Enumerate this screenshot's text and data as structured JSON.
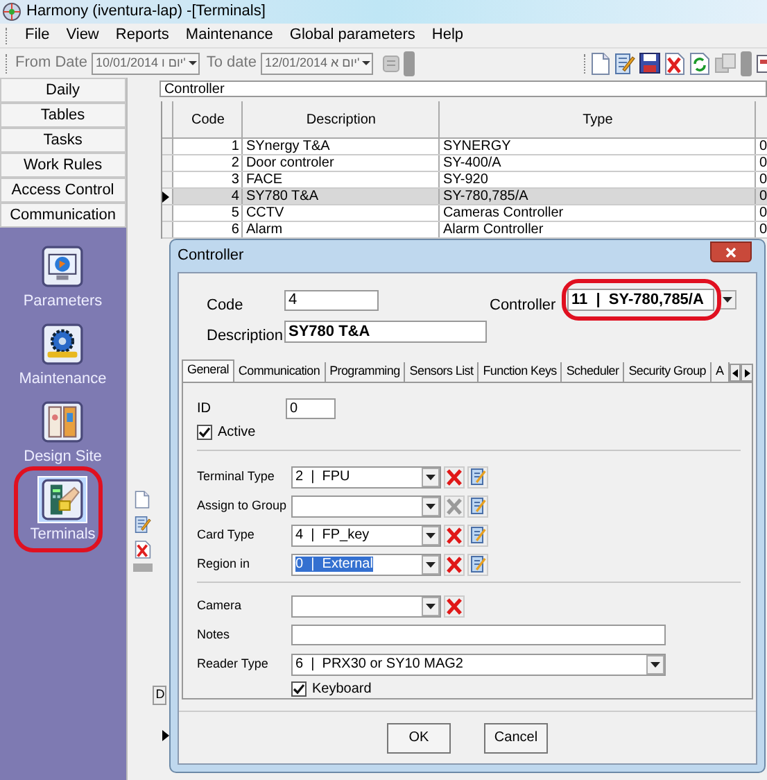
{
  "window": {
    "title": "Harmony (iventura-lap) -[Terminals]"
  },
  "menu": [
    "File",
    "View",
    "Reports",
    "Maintenance",
    "Global parameters",
    "Help"
  ],
  "toolbar": {
    "from_date": {
      "label": "From Date",
      "value": "10/01/2014 יום ו'"
    },
    "to_date": {
      "label": "To date",
      "value": "12/01/2014 יום א'"
    }
  },
  "sidebar": {
    "sections": [
      {
        "label": "Daily",
        "selected": false
      },
      {
        "label": "Tables",
        "selected": false
      },
      {
        "label": "Tasks",
        "selected": false
      },
      {
        "label": "Work Rules",
        "selected": false
      },
      {
        "label": "Access Control",
        "selected": false
      },
      {
        "label": "Communication",
        "selected": false
      }
    ],
    "modules": [
      {
        "label": "Parameters",
        "kind": "monitor",
        "selected": false,
        "circled": false
      },
      {
        "label": "Maintenance",
        "kind": "gear",
        "selected": false,
        "circled": false
      },
      {
        "label": "Design Site",
        "kind": "door",
        "selected": false,
        "circled": false
      },
      {
        "label": "Terminals",
        "kind": "terminal",
        "selected": true,
        "circled": true
      }
    ]
  },
  "grid": {
    "title": "Controller",
    "columns": [
      "Code",
      "Description",
      "Type"
    ],
    "rows": [
      {
        "code": "1",
        "description": "SYnergy T&A",
        "type": "SYNERGY",
        "column_4": "0",
        "selected": false
      },
      {
        "code": "2",
        "description": "Door controler",
        "type": "SY-400/A",
        "column_4": "0",
        "selected": false
      },
      {
        "code": "3",
        "description": "FACE",
        "type": "SY-920",
        "column_4": "0",
        "selected": false
      },
      {
        "code": "4",
        "description": "SY780 T&A",
        "type": "SY-780,785/A",
        "column_4": "0",
        "selected": true
      },
      {
        "code": "5",
        "description": "CCTV",
        "type": "Cameras Controller",
        "column_4": "0",
        "selected": false
      },
      {
        "code": "6",
        "description": "Alarm",
        "type": "Alarm Controller",
        "column_4": "0",
        "selected": false
      }
    ],
    "bottom_button": "D"
  },
  "dialog": {
    "title": "Controller",
    "code": {
      "label": "Code",
      "value": "4"
    },
    "controller": {
      "label": "Controller",
      "value": "11  |  SY-780,785/A",
      "circled": true
    },
    "description": {
      "label": "Description",
      "value": "SY780 T&A"
    },
    "tabs": [
      {
        "label": "General",
        "selected": true
      },
      {
        "label": "Communication",
        "selected": false
      },
      {
        "label": "Programming",
        "selected": false
      },
      {
        "label": "Sensors List",
        "selected": false
      },
      {
        "label": "Function Keys",
        "selected": false
      },
      {
        "label": "Scheduler",
        "selected": false
      },
      {
        "label": "Security Group",
        "selected": false
      },
      {
        "label": "A",
        "selected": false
      }
    ],
    "id": {
      "label": "ID",
      "value": "0"
    },
    "active": {
      "label": "Active",
      "checked": true
    },
    "fields": [
      {
        "kind": "combo",
        "label": "Terminal Type",
        "value": "2  |  FPU",
        "clear_enabled": true,
        "editable": true
      },
      {
        "kind": "combo",
        "label": "Assign to Group",
        "clear_enabled": false,
        "editable": true
      },
      {
        "kind": "combo",
        "label": "Card Type",
        "value": "4  |  FP_key",
        "clear_enabled": true,
        "editable": true
      },
      {
        "kind": "combo",
        "label": "Region in",
        "value": "0  |  External",
        "clear_enabled": true,
        "editable": true,
        "value_selected": true
      },
      {
        "kind": "separator"
      },
      {
        "kind": "combo",
        "label": "Camera",
        "clear_enabled": true
      },
      {
        "kind": "text",
        "label": "Notes"
      },
      {
        "kind": "wide-combo",
        "label": "Reader Type",
        "value": "6  |  PRX30 or SY10 MAG2"
      }
    ],
    "keyboard": {
      "label": "Keyboard",
      "checked": true
    },
    "buttons": [
      "OK",
      "Cancel"
    ]
  }
}
